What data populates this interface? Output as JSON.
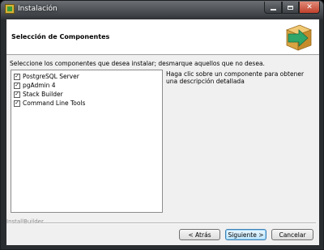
{
  "window": {
    "title": "Instalación",
    "icon": "installer-app-icon",
    "controls": [
      "minimize-icon",
      "maximize-icon",
      "close-icon"
    ]
  },
  "header": {
    "title": "Selección de Componentes",
    "graphic": "installer-box-arrow-icon"
  },
  "instructions": "Seleccione los componentes que desea instalar; desmarque aquellos que no desea.",
  "components": [
    {
      "label": "PostgreSQL Server",
      "checked": true
    },
    {
      "label": "pgAdmin 4",
      "checked": true
    },
    {
      "label": "Stack Builder",
      "checked": true
    },
    {
      "label": "Command Line Tools",
      "checked": true
    }
  ],
  "description": "Haga clic sobre un componente para obtener una descripción detallada",
  "footer": {
    "brand": "InstallBuilder",
    "back_label": "< Atrás",
    "next_label": "Siguiente >",
    "cancel_label": "Cancelar"
  },
  "colors": {
    "client_bg": "#f0f0f0",
    "header_bg": "#ffffff",
    "close_button": "#c0402b",
    "graphic_box": "#d9a441",
    "graphic_arrow": "#2fa66a"
  }
}
